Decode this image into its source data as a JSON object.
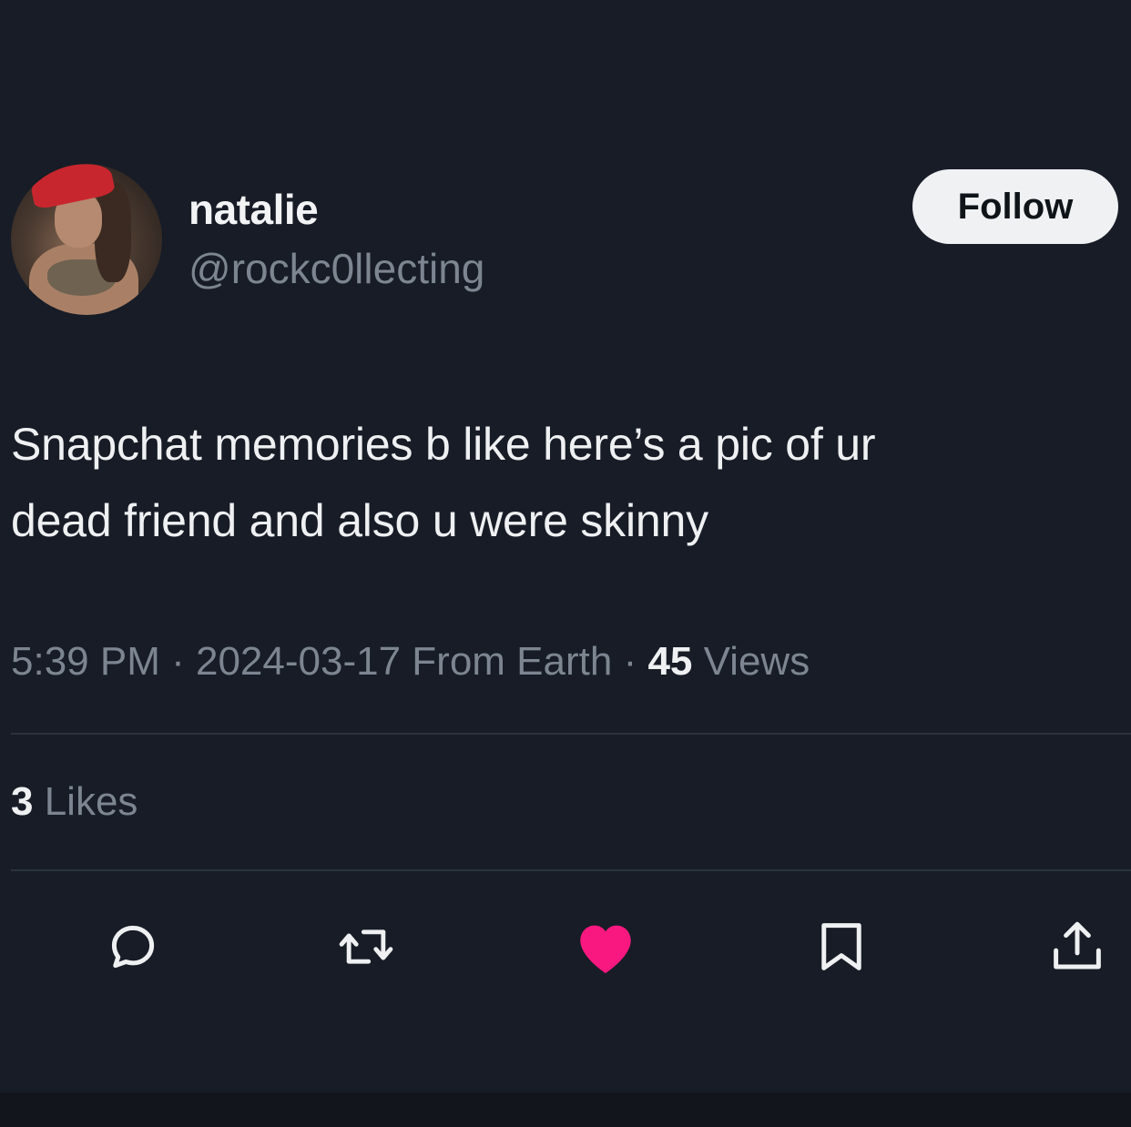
{
  "author": {
    "display_name": "natalie",
    "handle": "@rockc0llecting",
    "avatar_icon": "profile-photo"
  },
  "follow_button": {
    "label": "Follow"
  },
  "tweet": {
    "line1": "Snapchat memories b like here’s a pic of ur",
    "line2": "dead friend and also u were skinny"
  },
  "meta": {
    "time": "5:39 PM",
    "sep1": " · ",
    "date": "2024-03-17",
    "source": " From Earth",
    "sep2": " · ",
    "views_count": "45",
    "views_label": " Views"
  },
  "stats": {
    "likes_count": "3",
    "likes_label": " Likes"
  },
  "actions": [
    {
      "icon": "reply-icon"
    },
    {
      "icon": "retweet-icon"
    },
    {
      "icon": "heart-icon",
      "color": "#f91880",
      "active": true
    },
    {
      "icon": "bookmark-icon"
    },
    {
      "icon": "share-icon"
    }
  ],
  "colors": {
    "background": "#171c26",
    "text_primary": "#eef0f2",
    "text_secondary": "#7c8590",
    "like_active": "#f91880",
    "follow_bg": "#eff1f3"
  }
}
